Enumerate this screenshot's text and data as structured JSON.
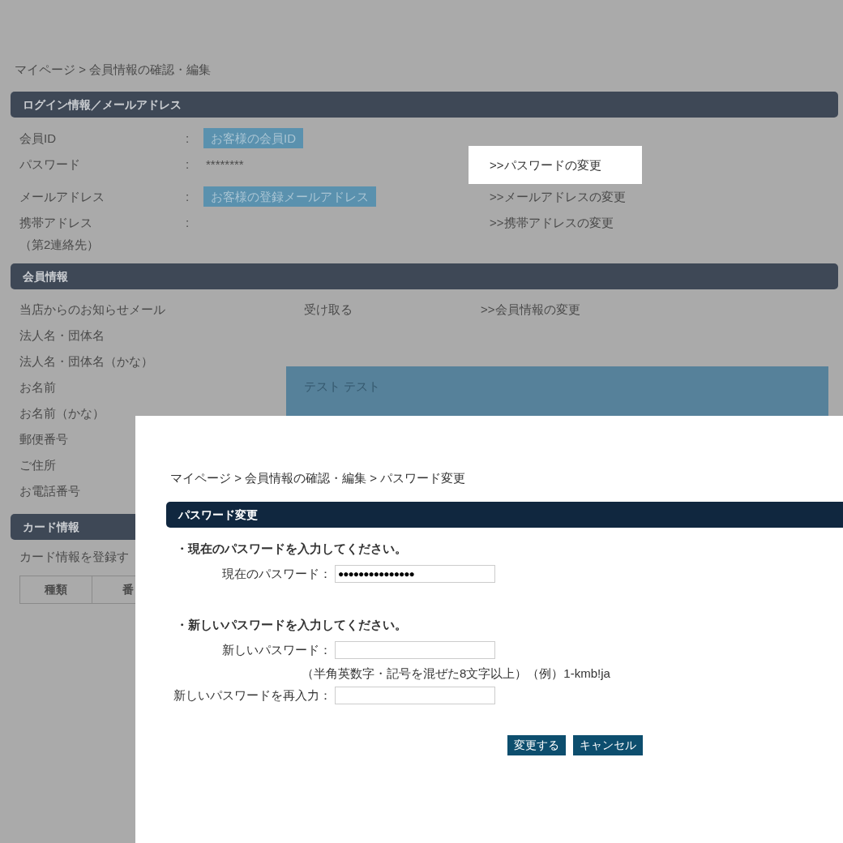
{
  "background_page": {
    "breadcrumb": "マイページ >  会員情報の確認・編集",
    "login_section": {
      "title": "ログイン情報／メールアドレス",
      "rows": [
        {
          "label": "会員ID",
          "separator": ":",
          "value": "お客様の会員ID",
          "kind": "badge"
        },
        {
          "label": "パスワード",
          "separator": ":",
          "value": "********",
          "kind": "text",
          "link": ">>パスワードの変更",
          "highlighted": true
        },
        {
          "label": "メールアドレス",
          "separator": ":",
          "value": "お客様の登録メールアドレス",
          "kind": "badge",
          "link": ">>メールアドレスの変更",
          "highlighted": false
        },
        {
          "label": "携帯アドレス",
          "sublabel": "（第2連絡先）",
          "separator": ":",
          "kind": "empty",
          "link": ">>携帯アドレスの変更",
          "highlighted": false
        }
      ]
    },
    "member_section": {
      "title": "会員情報",
      "rows": [
        {
          "label": "当店からのお知らせメール",
          "value": "受け取る",
          "link": ">>会員情報の変更"
        },
        {
          "label": "法人名・団体名"
        },
        {
          "label": "法人名・団体名（かな）"
        },
        {
          "label": "お名前"
        },
        {
          "label": "お名前（かな）"
        },
        {
          "label": "郵便番号"
        },
        {
          "label": "ご住所"
        },
        {
          "label": "お電話番号"
        }
      ],
      "highlight_box": {
        "text": "テスト テスト"
      }
    },
    "card_section": {
      "title": "カード情報",
      "note": "カード情報を登録す",
      "columns": [
        "種類",
        "番"
      ]
    }
  },
  "dialog": {
    "breadcrumb": "マイページ >  会員情報の確認・編集 >  パスワード変更",
    "title": "パスワード変更",
    "groups": [
      {
        "heading": "・現在のパスワードを入力してください。",
        "fields": [
          {
            "label": "現在のパスワード：",
            "value": "●●●●●●●●●●●●●●●"
          }
        ]
      },
      {
        "heading": "・新しいパスワードを入力してください。",
        "fields": [
          {
            "label": "新しいパスワード：",
            "hint": "（半角英数字・記号を混ぜた8文字以上）（例）1-kmb!ja"
          },
          {
            "label": "新しいパスワードを再入力："
          }
        ]
      }
    ],
    "buttons": [
      "変更する",
      "キャンセル"
    ]
  }
}
